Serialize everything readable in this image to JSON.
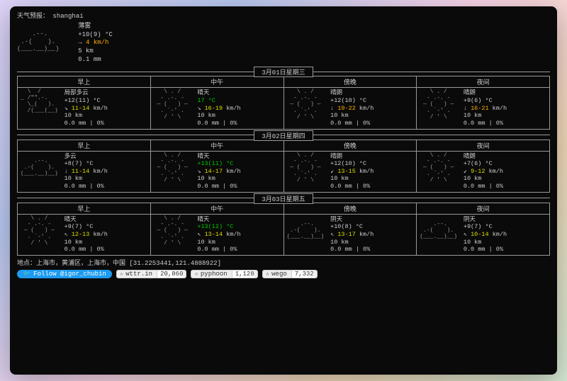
{
  "header": {
    "title": "天气预报：",
    "city": "shanghai"
  },
  "current": {
    "ascii": "             \n    .--.     \n .-(    ).   \n(___.__)__)  \n             ",
    "cond": "薄雾",
    "temp": "+10(9) °C",
    "wind_dir": "→",
    "wind": "4 km/h",
    "vis": "5 km",
    "prec": "0.1 mm"
  },
  "labels": [
    "早上",
    "中午",
    "傍晚",
    "夜间"
  ],
  "days": [
    {
      "date": "3月01日星期三",
      "cells": [
        {
          "ascii": "  \\  /      \n_ /\"\".-.    \n  \\_(   ).  \n  /(___(__) ",
          "cond": "局部多云",
          "temp": "+12(11) °C",
          "wdir": "↘",
          "wind": "11-14",
          "windcolor": "y",
          "vis": "10 km",
          "prec": "0.0 mm | 0%"
        },
        {
          "ascii": "   \\ . /    \n  - .-. -   \n ― (   ) ―  \n  . `-' .   \n   / ' \\   ",
          "cond": "晴天",
          "temp_g": "17 °C",
          "wdir": "↘",
          "wind": "16-19",
          "windcolor": "y",
          "vis": "10 km",
          "prec": "0.0 mm | 0%"
        },
        {
          "ascii": "   \\ . /    \n  - .-. -   \n ― (   ) ―  \n  . `-' .   \n   / ' \\   ",
          "cond": "晴朗",
          "temp": "+12(10) °C",
          "wdir": "↓",
          "wind": "19-22",
          "windcolor": "o",
          "vis": "10 km",
          "prec": "0.0 mm | 0%"
        },
        {
          "ascii": "   \\ . /    \n  - .-. -   \n ― (   ) ―  \n  . `-' .   \n   / ' \\   ",
          "cond": "晴朗",
          "temp": "+9(6) °C",
          "wdir": "↓",
          "wind": "16-21",
          "windcolor": "o",
          "vis": "10 km",
          "prec": "0.0 mm | 0%"
        }
      ]
    },
    {
      "date": "3月02日星期四",
      "cells": [
        {
          "ascii": "            \n    .--.    \n .-(    ).  \n(___.__)__)",
          "cond": "多云",
          "temp": "+8(7) °C",
          "wdir": "↓",
          "wind": "11-14",
          "windcolor": "y",
          "vis": "10 km",
          "prec": "0.0 mm | 0%"
        },
        {
          "ascii": "   \\ . /    \n  - .-. -   \n ― (   ) ―  \n  . `-' .   \n   / ' \\   ",
          "cond": "晴天",
          "temp_g": "+13(11) °C",
          "wdir": "↘",
          "wind": "14-17",
          "windcolor": "y",
          "vis": "10 km",
          "prec": "0.0 mm | 0%"
        },
        {
          "ascii": "   \\ . /    \n  - .-. -   \n ― (   ) ―  \n  . `-' .   \n   / ' \\   ",
          "cond": "晴朗",
          "temp": "+12(10) °C",
          "wdir": "↙",
          "wind": "13-15",
          "windcolor": "y",
          "vis": "10 km",
          "prec": "0.0 mm | 0%"
        },
        {
          "ascii": "   \\ . /    \n  - .-. -   \n ― (   ) ―  \n  . `-' .   \n   / ' \\   ",
          "cond": "晴朗",
          "temp": "+7(6) °C",
          "wdir": "↙",
          "wind": "9-12",
          "windcolor": "y",
          "vis": "10 km",
          "prec": "0.0 mm | 0%"
        }
      ]
    },
    {
      "date": "3月03日星期五",
      "cells": [
        {
          "ascii": "   \\ . /    \n  - .-. -   \n ― (   ) ―  \n  . `-' .   \n   / ' \\   ",
          "cond": "晴天",
          "temp": "+9(7) °C",
          "wdir": "↖",
          "wind": "12-13",
          "windcolor": "y",
          "vis": "10 km",
          "prec": "0.0 mm | 0%"
        },
        {
          "ascii": "   \\ . /    \n  - .-. -   \n ― (   ) ―  \n  . `-' .   \n   / ' \\   ",
          "cond": "晴天",
          "temp_g": "+13(12) °C",
          "wdir": "↖",
          "wind": "13-14",
          "windcolor": "y",
          "vis": "10 km",
          "prec": "0.0 mm | 0%"
        },
        {
          "ascii": "            \n    .--.    \n .-(    ).  \n(___.__)__)",
          "cond": "阴天",
          "temp": "+10(8) °C",
          "wdir": "↖",
          "wind": "13-17",
          "windcolor": "y",
          "vis": "10 km",
          "prec": "0.0 mm | 0%"
        },
        {
          "ascii": "            \n    .--.    \n .-(    ).  \n(___.__)__)",
          "cond": "阴天",
          "temp": "+9(7) °C",
          "wdir": "↖",
          "wind": "10-14",
          "windcolor": "y",
          "vis": "10 km",
          "prec": "0.0 mm | 0%"
        }
      ]
    }
  ],
  "location": "地点：上海市，黄浦区，上海市，中国 [31.2253441,121.4888922]",
  "footer": {
    "follow": "Follow @igor_chubin",
    "badges": [
      {
        "name": "wttr.in",
        "count": "20,860"
      },
      {
        "name": "pyphoon",
        "count": "1,128"
      },
      {
        "name": "wego",
        "count": "7,332"
      }
    ]
  }
}
